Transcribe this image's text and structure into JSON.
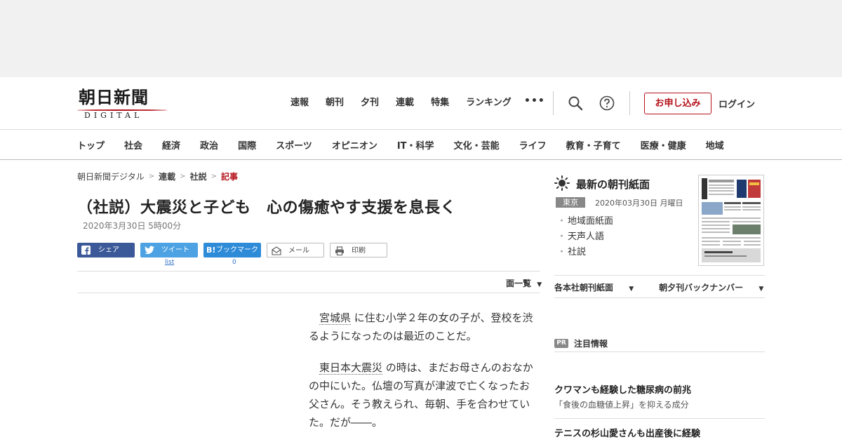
{
  "logo": {
    "main": "朝日新聞",
    "sub": "DIGITAL"
  },
  "topnav": [
    "速報",
    "朝刊",
    "夕刊",
    "連載",
    "特集",
    "ランキング"
  ],
  "more": "•••",
  "apply_label": "お申し込み",
  "login_label": "ログイン",
  "categories": [
    "トップ",
    "社会",
    "経済",
    "政治",
    "国際",
    "スポーツ",
    "オピニオン",
    "IT・科学",
    "文化・芸能",
    "ライフ",
    "教育・子育て",
    "医療・健康",
    "地域"
  ],
  "breadcrumb": [
    "朝日新聞デジタル",
    "連載",
    "社説",
    "記事"
  ],
  "article": {
    "title": "（社説）大震災と子ども　心の傷癒やす支援を息長く",
    "date": "2020年3月30日 5時00分",
    "p1_link": "宮城県",
    "p1_text": "に住む小学２年の女の子が、登校を渋るようになったのは最近のことだ。",
    "p2_link": "東日本大震災",
    "p2_text": "の時は、まだお母さんのおなかの中にいた。仏壇の写真が津波で亡くなったお父さん。そう教えられ、毎朝、手を合わせていた。だが――。"
  },
  "share": {
    "facebook": "シェア",
    "twitter": "ツイート",
    "twitter_count": "list",
    "hatena": "ブックマーク",
    "hatena_count": "0",
    "mail": "メール",
    "print": "印刷"
  },
  "menu_list_label": "面一覧",
  "sidebar": {
    "title": "最新の朝刊紙面",
    "edition": "東京",
    "edition_date": "2020年03月30日 月曜日",
    "links": [
      "地域面紙面",
      "天声人語",
      "社説"
    ],
    "sub_links": [
      "各本社朝刊紙面",
      "朝夕刊バックナンバー"
    ],
    "pr_badge": "PR",
    "pr_title": "注目情報",
    "pr_items": [
      {
        "title": "クワマンも経験した糖尿病の前兆",
        "sub": "「食後の血糖値上昇」を抑える成分"
      },
      {
        "title": "テニスの杉山愛さんも出産後に経験",
        "sub": ""
      }
    ]
  },
  "colors": {
    "brand_red": "#b5121b",
    "facebook": "#3b5998",
    "twitter": "#4da2e3",
    "hatena": "#2e8bd8"
  }
}
